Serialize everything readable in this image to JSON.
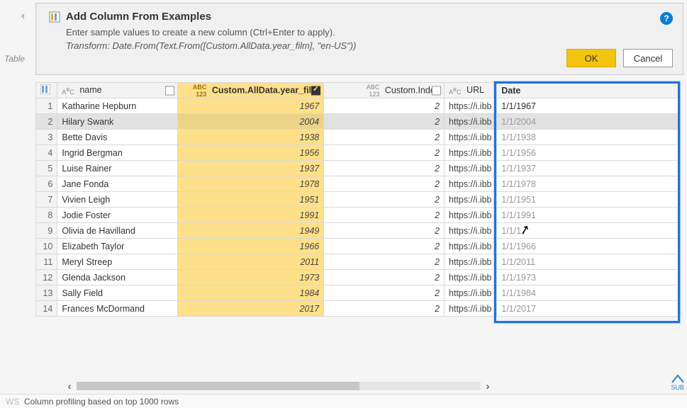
{
  "left_panel": {
    "table_label": "Table"
  },
  "dialog": {
    "title": "Add Column From Examples",
    "subtitle": "Enter sample values to create a new column (Ctrl+Enter to apply).",
    "transform": "Transform: Date.From(Text.From([Custom.AllData.year_film], \"en-US\"))",
    "ok": "OK",
    "cancel": "Cancel"
  },
  "columns": {
    "name": "name",
    "year": "Custom.AllData.year_film",
    "index": "Custom.Index",
    "url": "URL",
    "date": "Date"
  },
  "type_labels": {
    "abc": "ABC",
    "abc123": "ABC\n123"
  },
  "rows": [
    {
      "n": 1,
      "name": "Katharine Hepburn",
      "year": "1967",
      "index": "2",
      "url": "https://i.ibb",
      "date": "1/1/1967"
    },
    {
      "n": 2,
      "name": "Hilary Swank",
      "year": "2004",
      "index": "2",
      "url": "https://i.ibb",
      "date": "1/1/2004"
    },
    {
      "n": 3,
      "name": "Bette Davis",
      "year": "1938",
      "index": "2",
      "url": "https://i.ibb",
      "date": "1/1/1938"
    },
    {
      "n": 4,
      "name": "Ingrid Bergman",
      "year": "1956",
      "index": "2",
      "url": "https://i.ibb",
      "date": "1/1/1956"
    },
    {
      "n": 5,
      "name": "Luise Rainer",
      "year": "1937",
      "index": "2",
      "url": "https://i.ibb",
      "date": "1/1/1937"
    },
    {
      "n": 6,
      "name": "Jane Fonda",
      "year": "1978",
      "index": "2",
      "url": "https://i.ibb",
      "date": "1/1/1978"
    },
    {
      "n": 7,
      "name": "Vivien Leigh",
      "year": "1951",
      "index": "2",
      "url": "https://i.ibb",
      "date": "1/1/1951"
    },
    {
      "n": 8,
      "name": "Jodie Foster",
      "year": "1991",
      "index": "2",
      "url": "https://i.ibb",
      "date": "1/1/1991"
    },
    {
      "n": 9,
      "name": "Olivia de Havilland",
      "year": "1949",
      "index": "2",
      "url": "https://i.ibb",
      "date": "1/1/1"
    },
    {
      "n": 10,
      "name": "Elizabeth Taylor",
      "year": "1966",
      "index": "2",
      "url": "https://i.ibb",
      "date": "1/1/1966"
    },
    {
      "n": 11,
      "name": "Meryl Streep",
      "year": "2011",
      "index": "2",
      "url": "https://i.ibb",
      "date": "1/1/2011"
    },
    {
      "n": 12,
      "name": "Glenda Jackson",
      "year": "1973",
      "index": "2",
      "url": "https://i.ibb",
      "date": "1/1/1973"
    },
    {
      "n": 13,
      "name": "Sally Field",
      "year": "1984",
      "index": "2",
      "url": "https://i.ibb",
      "date": "1/1/1984"
    },
    {
      "n": 14,
      "name": "Frances McDormand",
      "year": "2017",
      "index": "2",
      "url": "https://i.ibb",
      "date": "1/1/2017"
    }
  ],
  "selected_row_index": 1,
  "status": {
    "ws_fragment": "WS",
    "profiling": "Column profiling based on top 1000 rows"
  },
  "sub_label": "SUB"
}
